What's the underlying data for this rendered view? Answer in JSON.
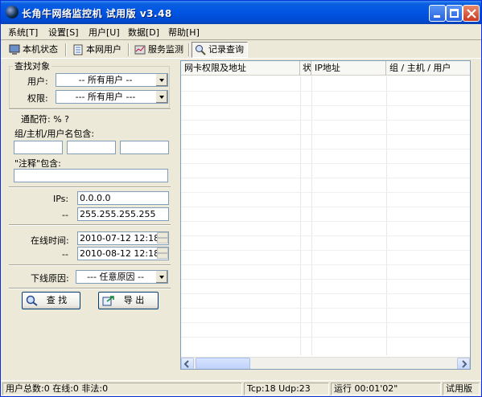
{
  "window": {
    "title": "长角牛网络监控机 试用版 v3.48"
  },
  "menu": [
    "系统[T]",
    "设置[S]",
    "用户[U]",
    "数据[D]",
    "帮助[H]"
  ],
  "toolbar": {
    "tabs": [
      {
        "label": "本机状态",
        "icon": "computer-icon"
      },
      {
        "label": "本网用户",
        "icon": "network-users-icon"
      },
      {
        "label": "服务监测",
        "icon": "service-monitor-icon"
      },
      {
        "label": "记录查询",
        "icon": "magnifier-icon",
        "active": true
      }
    ]
  },
  "search": {
    "group_title": "查找对象",
    "user_label": "用户:",
    "user_value": "-- 所有用户 --",
    "perm_label": "权限:",
    "perm_value": "--- 所有用户 ---",
    "wildcard_label": "通配符: % ?",
    "name_contains_label": "组/主机/用户名包含:",
    "name_fields": [
      "",
      "",
      ""
    ],
    "note_contains_label": "\"注释\"包含:",
    "note_value": "",
    "ip_label": "IPs:",
    "ip_from": "0.0.0.0",
    "ip_sep": "--",
    "ip_to": "255.255.255.255",
    "online_time_label": "在线时间:",
    "time_from": "2010-07-12 12:18",
    "time_sep": "--",
    "time_to": "2010-08-12 12:18",
    "offline_reason_label": "下线原因:",
    "offline_reason_value": "--- 任意原因 --",
    "find_button": "查 找",
    "export_button": "导 出"
  },
  "grid": {
    "columns": [
      "网卡权限及地址",
      "状",
      "IP地址",
      "组 / 主机 / 用户"
    ],
    "rows": []
  },
  "status": {
    "counts": "用户总数:0 在线:0 非法:0",
    "tcp_udp": "Tcp:18 Udp:23",
    "runtime": "运行 00:01'02\"",
    "edition": "试用版"
  },
  "colors": {
    "title_bar": "#0054E3",
    "window_bg": "#ECE9D8",
    "accent_border": "#7F9DB9"
  }
}
